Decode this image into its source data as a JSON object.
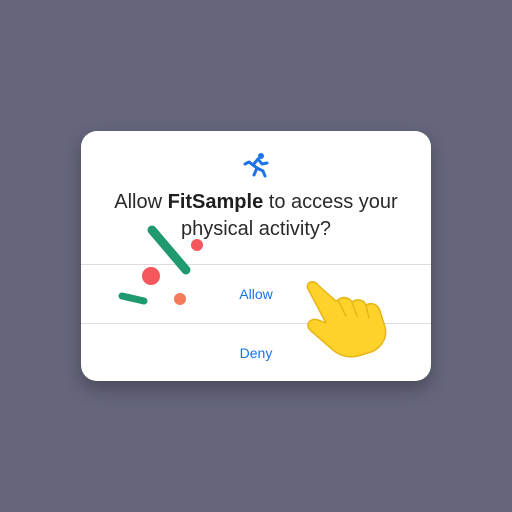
{
  "dialog": {
    "app_icon": "running-person-icon",
    "message_prefix": "Allow ",
    "app_name": "FitSample",
    "message_line1_suffix": " to access your",
    "message_line2": "physical activity?",
    "allow_label": "Allow",
    "deny_label": "Deny"
  },
  "decorations": {
    "hand_pointer": "pointing-hand-icon",
    "confetti_colors": [
      "#1e9a6e",
      "#f5575d",
      "#f37b59"
    ]
  },
  "colors": {
    "background": "#65667c",
    "dialog": "#ffffff",
    "accent": "#1a73e8",
    "hand": "#ffd12b"
  }
}
